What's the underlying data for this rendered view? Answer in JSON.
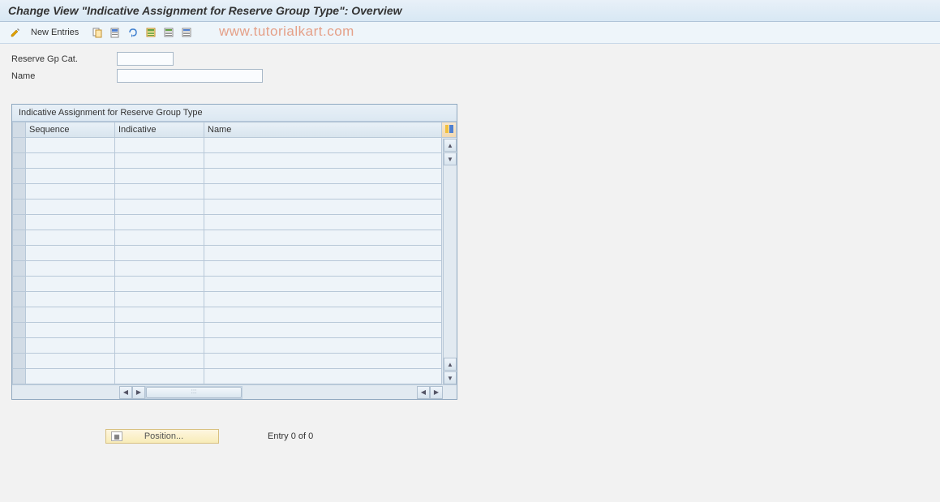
{
  "header": {
    "title": "Change View \"Indicative Assignment for Reserve Group Type\": Overview"
  },
  "toolbar": {
    "new_entries_label": "New Entries"
  },
  "watermark": {
    "text": "www.tutorialkart.com"
  },
  "form": {
    "reserve_gp_cat_label": "Reserve Gp Cat.",
    "reserve_gp_cat_value": "",
    "name_label": "Name",
    "name_value": ""
  },
  "table": {
    "caption": "Indicative Assignment for Reserve Group Type",
    "columns": {
      "sequence": "Sequence",
      "indicative": "Indicative",
      "name": "Name"
    },
    "row_count": 16,
    "rows": []
  },
  "footer": {
    "position_label": "Position...",
    "entry_text": "Entry 0 of 0"
  }
}
